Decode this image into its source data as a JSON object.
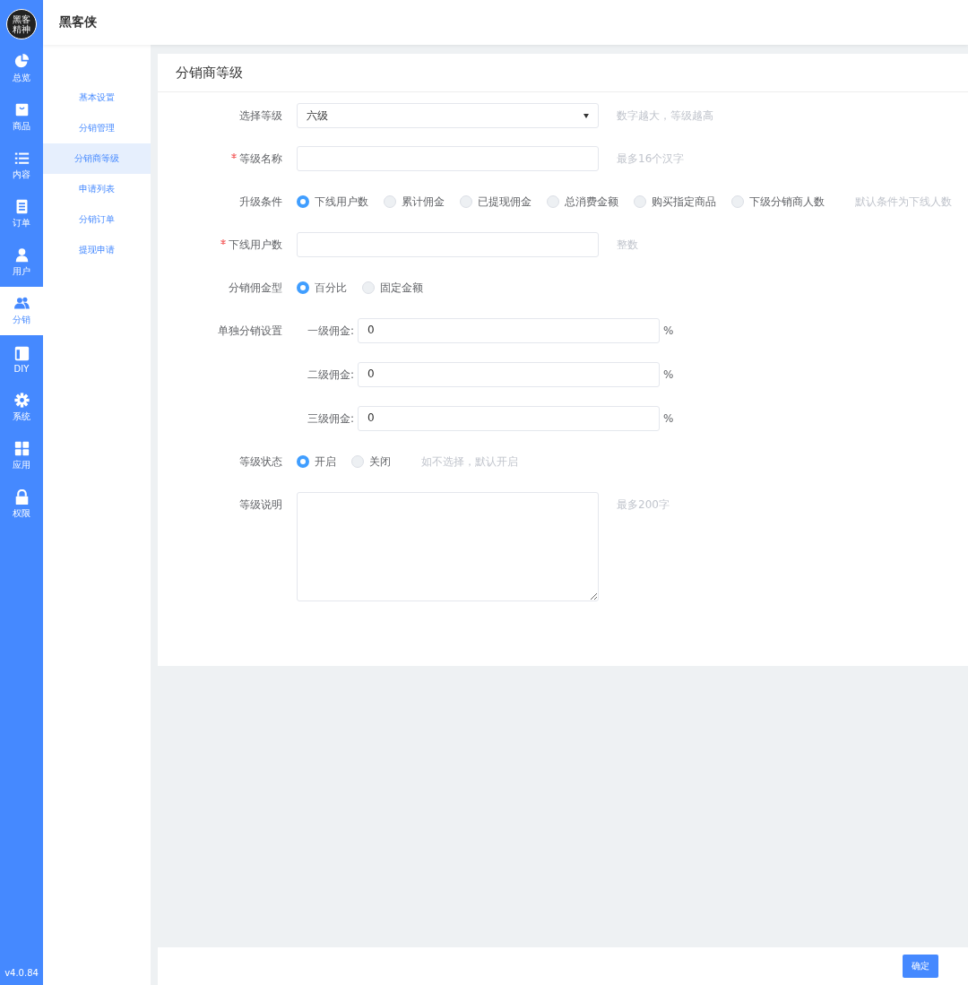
{
  "logo": {
    "lines": [
      "黑客",
      "精神"
    ]
  },
  "nav": [
    {
      "label": "总览",
      "selected": false
    },
    {
      "label": "商品",
      "selected": false
    },
    {
      "label": "内容",
      "selected": false
    },
    {
      "label": "订单",
      "selected": false
    },
    {
      "label": "用户",
      "selected": false
    },
    {
      "label": "分销",
      "selected": true
    },
    {
      "label": "DIY",
      "selected": false
    },
    {
      "label": "系统",
      "selected": false
    },
    {
      "label": "应用",
      "selected": false
    },
    {
      "label": "权限",
      "selected": false
    }
  ],
  "version": "v4.0.84",
  "header": {
    "title": "黑客侠"
  },
  "submenu": [
    {
      "label": "基本设置",
      "selected": false
    },
    {
      "label": "分销管理",
      "selected": false
    },
    {
      "label": "分销商等级",
      "selected": true
    },
    {
      "label": "申请列表",
      "selected": false
    },
    {
      "label": "分销订单",
      "selected": false
    },
    {
      "label": "提现申请",
      "selected": false
    }
  ],
  "page_title": "分销商等级",
  "form": [
    {
      "kind": "select",
      "label": "选择等级",
      "required": false,
      "value": "六级",
      "hint": "数字越大，等级越高"
    },
    {
      "kind": "input",
      "label": "等级名称",
      "required": true,
      "hint": "最多16个汉字"
    },
    {
      "kind": "radio",
      "label": "升级条件",
      "required": false,
      "options": [
        {
          "label": "下线用户数",
          "selected": true
        },
        {
          "label": "累计佣金",
          "selected": false
        },
        {
          "label": "已提现佣金",
          "selected": false
        },
        {
          "label": "总消费金额",
          "selected": false
        },
        {
          "label": "购买指定商品",
          "selected": false
        },
        {
          "label": "下级分销商人数",
          "selected": false
        }
      ],
      "hint": "默认条件为下线人数"
    },
    {
      "kind": "input",
      "label": "下线用户数",
      "required": true,
      "hint": "整数"
    },
    {
      "kind": "radio",
      "label": "分销佣金型",
      "required": false,
      "options": [
        {
          "label": "百分比",
          "selected": true
        },
        {
          "label": "固定金额",
          "selected": false
        }
      ]
    },
    {
      "kind": "commission",
      "label": "单独分销设置",
      "required": false,
      "levels": [
        {
          "label": "一级佣金:",
          "value": "0",
          "unit": "%"
        },
        {
          "label": "二级佣金:",
          "value": "0",
          "unit": "%"
        },
        {
          "label": "三级佣金:",
          "value": "0",
          "unit": "%"
        }
      ]
    },
    {
      "kind": "radio",
      "label": "等级状态",
      "required": false,
      "options": [
        {
          "label": "开启",
          "selected": true
        },
        {
          "label": "关闭",
          "selected": false
        }
      ],
      "hint": "如不选择，默认开启"
    },
    {
      "kind": "textarea",
      "label": "等级说明",
      "required": false,
      "hint": "最多200字"
    }
  ],
  "footer": {
    "button": "确定"
  }
}
